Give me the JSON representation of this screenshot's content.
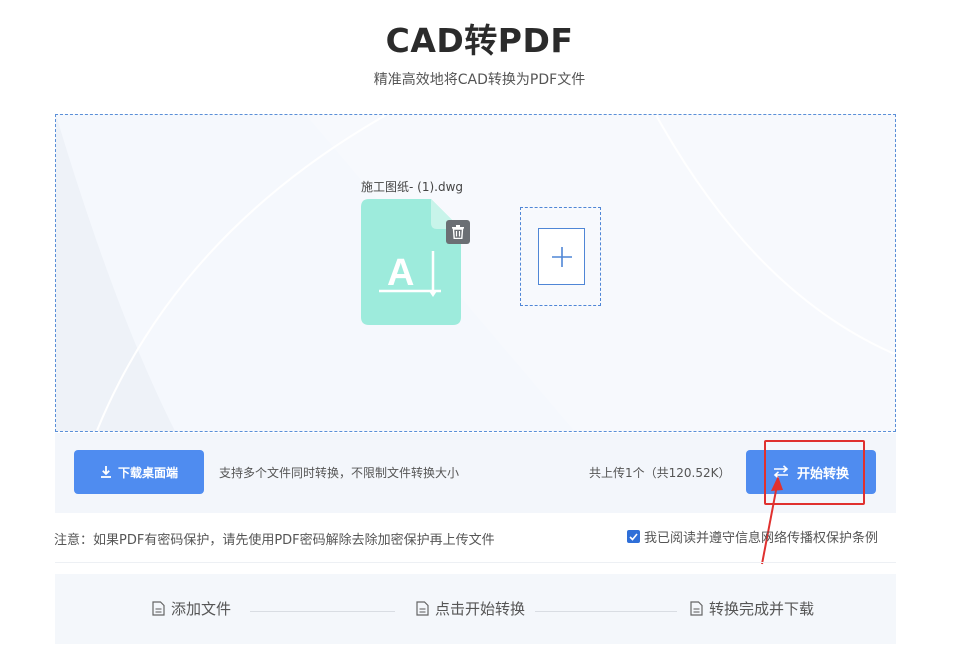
{
  "header": {
    "title": "CAD转PDF",
    "subtitle": "精准高效地将CAD转换为PDF文件"
  },
  "dropzone": {
    "file": {
      "name": "施工图纸- (1).dwg",
      "icon": "cad-file-icon",
      "delete_icon": "trash-icon"
    },
    "add_icon": "plus-icon"
  },
  "toolbar": {
    "download_label": "下载桌面端",
    "support_text": "支持多个文件同时转换，不限制文件转换大小",
    "count_text": "共上传1个（共120.52K）",
    "convert_label": "开始转换"
  },
  "notice": {
    "text": "注意：如果PDF有密码保护，请先使用PDF密码解除去除加密保护再上传文件",
    "agree_label": "我已阅读并遵守信息网络传播权保护条例",
    "agree_checked": true
  },
  "steps": [
    {
      "label": "添加文件"
    },
    {
      "label": "点击开始转换"
    },
    {
      "label": "转换完成并下载"
    }
  ],
  "colors": {
    "accent": "#4f8cf0",
    "file_icon": "#9debdc",
    "highlight": "#e0312f"
  }
}
